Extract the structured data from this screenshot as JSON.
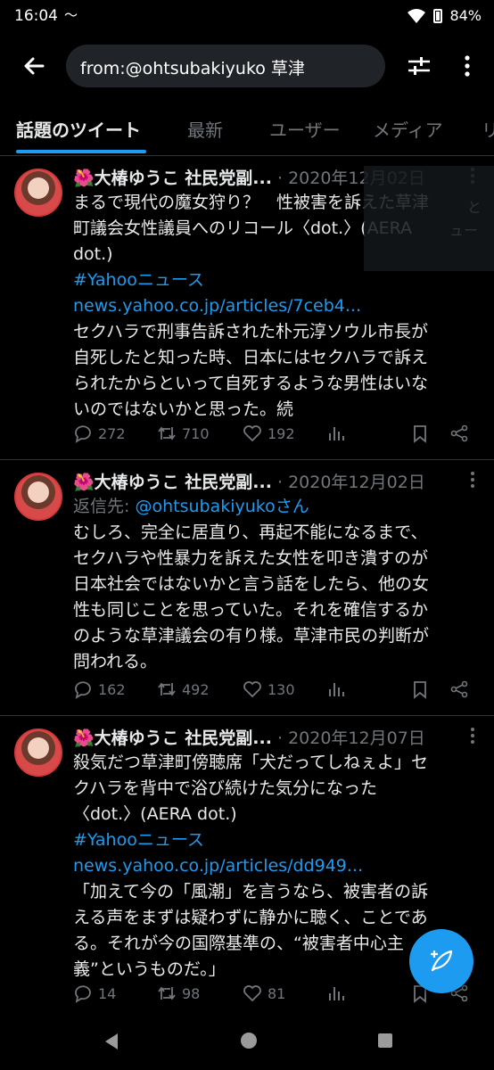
{
  "status_bar": {
    "time": "16:04",
    "battery": "84%"
  },
  "search": {
    "query": "from:@ohtsubakiyuko 草津"
  },
  "tabs": [
    {
      "label": "話題のツイート"
    },
    {
      "label": "最新"
    },
    {
      "label": "ユーザー"
    },
    {
      "label": "メディア"
    },
    {
      "label": "リ"
    }
  ],
  "tweets": [
    {
      "flower": "🌺",
      "name": "大椿ゆうこ 社民党副...",
      "sep": " · ",
      "date": "2020年12月02日",
      "lines": [
        "まるで現代の魔女狩り？　性被害を訴えた草津",
        "町議会女性議員へのリコール〈dot.〉(AERA",
        "dot.)"
      ],
      "hashtag": "#Yahooニュース",
      "url": "news.yahoo.co.jp/articles/7ceb4...",
      "quote": [
        "セクハラで刑事告訴された朴元淳ソウル市長が",
        "自死したと知った時、日本にはセクハラで訴え",
        "られたからといって自死するような男性はいな",
        "いのではないかと思った。続"
      ],
      "replies": "272",
      "retweets": "710",
      "likes": "192"
    },
    {
      "flower": "🌺",
      "name": "大椿ゆうこ 社民党副...",
      "sep": " · ",
      "date": "2020年12月02日",
      "reply_prefix": "返信先: ",
      "reply_to": "@ohtsubakiyukoさん",
      "lines": [
        "むしろ、完全に居直り、再起不能になるまで、",
        "セクハラや性暴力を訴えた女性を叩き潰すのが",
        "日本社会ではないかと言う話をしたら、他の女",
        "性も同じことを思っていた。それを確信するか",
        "のような草津議会の有り様。草津市民の判断が",
        "問われる。"
      ],
      "replies": "162",
      "retweets": "492",
      "likes": "130"
    },
    {
      "flower": "🌺",
      "name": "大椿ゆうこ 社民党副...",
      "sep": " · ",
      "date": "2020年12月07日",
      "lines": [
        "殺気だつ草津町傍聴席「犬だってしねぇよ」セ",
        "クハラを背中で浴び続けた気分になった",
        "〈dot.〉(AERA dot.)"
      ],
      "hashtag": "#Yahooニュース",
      "url": "news.yahoo.co.jp/articles/dd949...",
      "quote": [
        "「加えて今の「風潮」を言うなら、被害者の訴",
        "える声をまずは疑わずに静かに聴く、ことであ",
        "る。それが今の国際基準の、“被害者中心主",
        "義”というものだ。」"
      ],
      "replies": "14",
      "retweets": "98",
      "likes": "81"
    }
  ],
  "overlay_text": [
    "と",
    "ュー"
  ]
}
